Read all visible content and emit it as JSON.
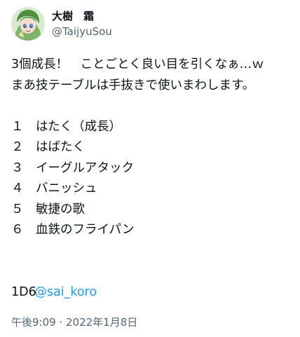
{
  "user": {
    "display_name": "大樹　霜",
    "handle": "@TaijyuSou",
    "avatar": "avatar-icon"
  },
  "tweet": {
    "lines": [
      "3個成長！　ことごとく良い目を引くなぁ…ｗ",
      "まあ技テーブルは手抜きで使いまわします。"
    ],
    "list": [
      "１　はたく（成長）",
      "２　はばたく",
      "３　イーグルアタック",
      "４　バニッシュ",
      "５　敏捷の歌",
      "６　血鉄のフライパン"
    ],
    "mention": "@sai_koro",
    "dice": "1D6",
    "timestamp": "午後9:09 · 2022年1月8日"
  },
  "colors": {
    "text": "#0f1419",
    "secondary": "#536471",
    "link": "#1d9bf0"
  }
}
